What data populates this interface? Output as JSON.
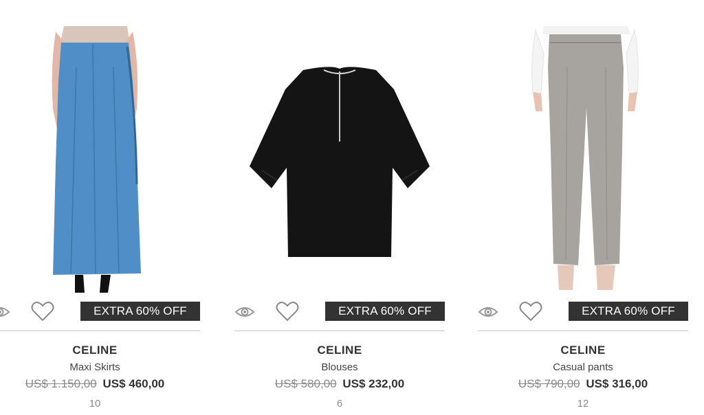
{
  "products": [
    {
      "brand": "CELINE",
      "category": "Maxi Skirts",
      "old_price": "US$ 1.150,00",
      "new_price": "US$ 460,00",
      "count": "10",
      "badge": "EXTRA 60% OFF",
      "image_icon": "blue-maxi-skirt-photo"
    },
    {
      "brand": "CELINE",
      "category": "Blouses",
      "old_price": "US$ 580,00",
      "new_price": "US$ 232,00",
      "count": "6",
      "badge": "EXTRA 60% OFF",
      "image_icon": "black-blouse-photo"
    },
    {
      "brand": "CELINE",
      "category": "Casual pants",
      "old_price": "US$ 790,00",
      "new_price": "US$ 316,00",
      "count": "12",
      "badge": "EXTRA 60% OFF",
      "image_icon": "grey-pants-photo"
    }
  ],
  "icons": {
    "quick_view": "eye-icon",
    "wishlist": "heart-icon"
  },
  "colors": {
    "badge_background": "#333333",
    "badge_text": "#ffffff",
    "old_price": "#8a8a8a",
    "divider": "#c8c8c8"
  }
}
